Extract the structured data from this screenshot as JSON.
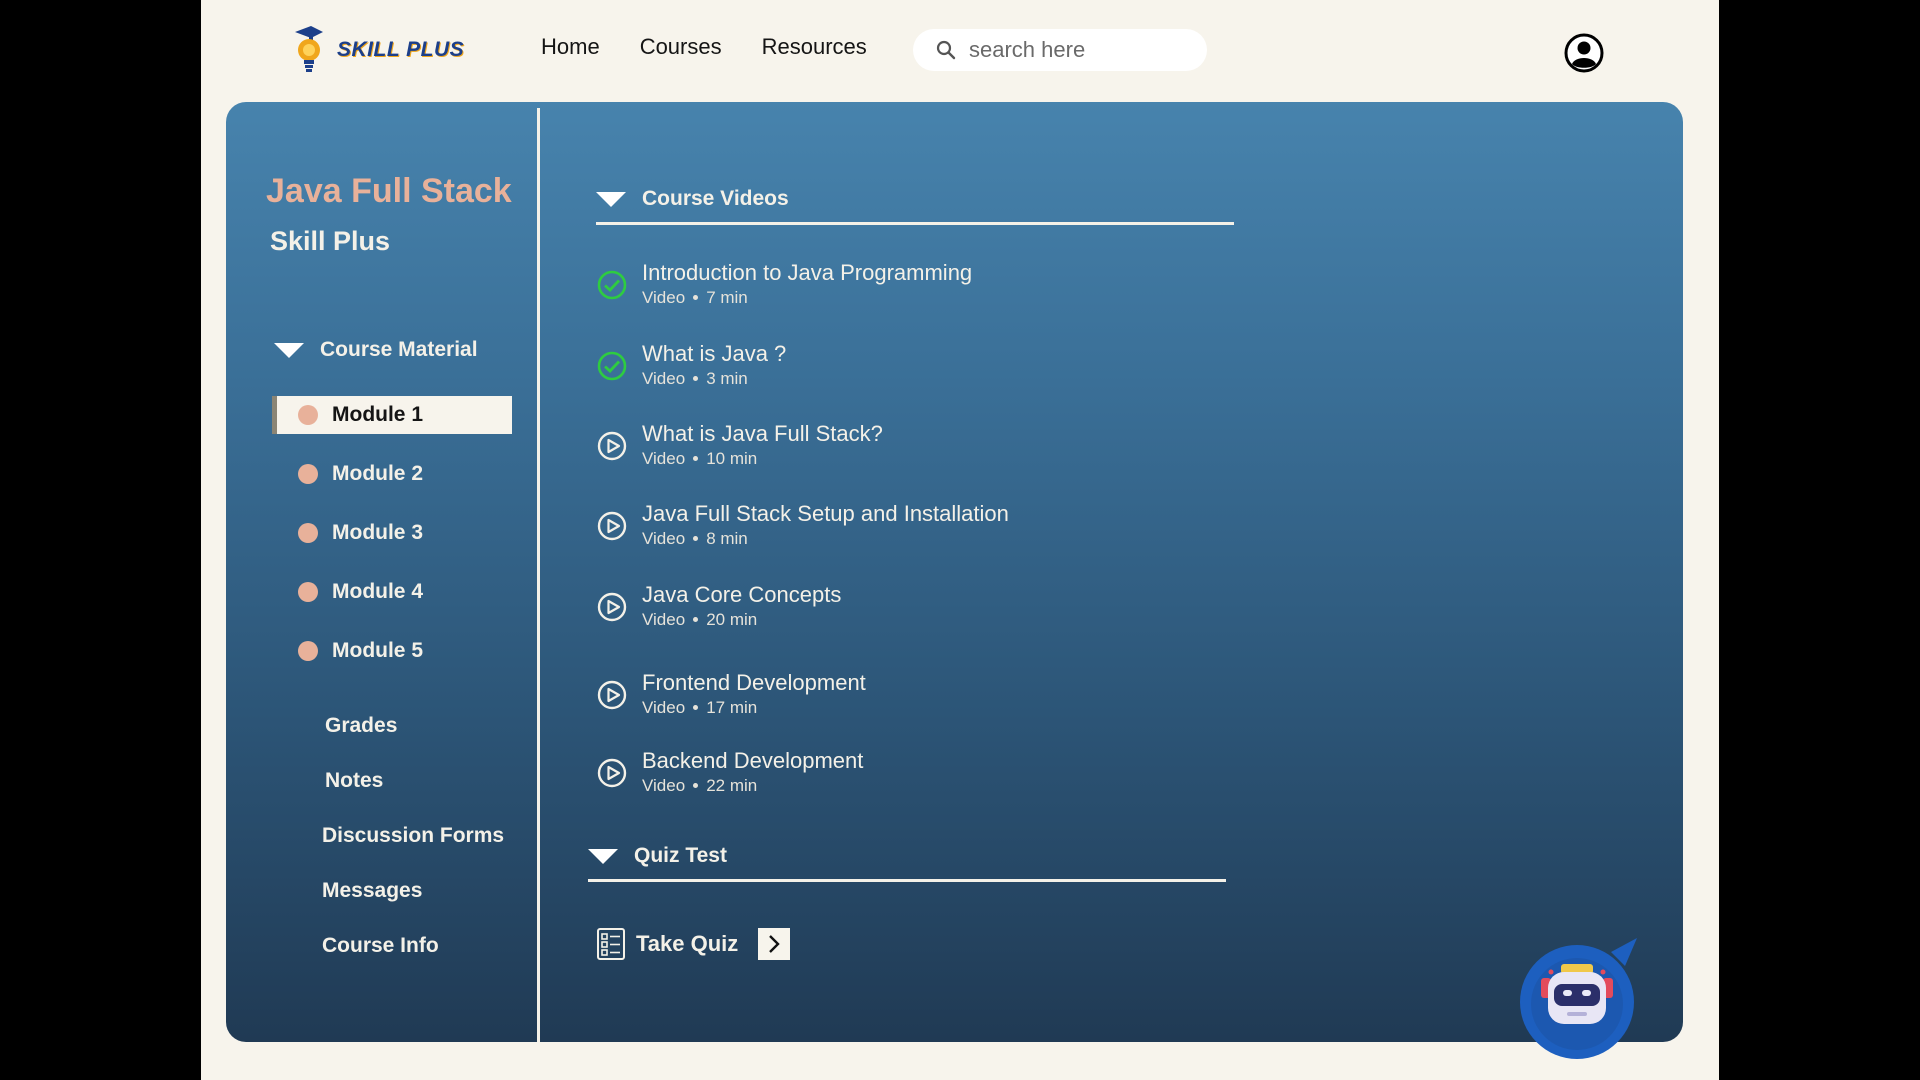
{
  "header": {
    "logo_text": "SKILL PLUS",
    "nav": [
      "Home",
      "Courses",
      "Resources"
    ],
    "search_placeholder": "search here"
  },
  "course": {
    "title": "Java Full Stack",
    "provider": "Skill Plus"
  },
  "sidebar": {
    "section_label": "Course Material",
    "modules": [
      "Module 1",
      "Module 2",
      "Module 3",
      "Module 4",
      "Module 5"
    ],
    "active_module": "Module 1",
    "links": [
      "Grades",
      "Notes",
      "Discussion Forms",
      "Messages",
      "Course Info"
    ]
  },
  "videos_section": {
    "label": "Course Videos",
    "items": [
      {
        "title": "Introduction to Java Programming",
        "type": "Video",
        "duration": "7 min",
        "status": "completed",
        "icon": "check-circle-icon"
      },
      {
        "title": "What is Java ?",
        "type": "Video",
        "duration": "3 min",
        "status": "completed",
        "icon": "check-circle-icon"
      },
      {
        "title": "What is Java Full Stack?",
        "type": "Video",
        "duration": "10 min",
        "status": "pending",
        "icon": "play-circle-icon"
      },
      {
        "title": "Java Full Stack Setup and Installation",
        "type": "Video",
        "duration": "8 min",
        "status": "pending",
        "icon": "play-circle-icon"
      },
      {
        "title": "Java Core Concepts",
        "type": "Video",
        "duration": "20 min",
        "status": "pending",
        "icon": "play-circle-icon"
      },
      {
        "title": "Frontend Development",
        "type": "Video",
        "duration": "17 min",
        "status": "pending",
        "icon": "play-circle-icon"
      },
      {
        "title": "Backend Development",
        "type": "Video",
        "duration": "22 min",
        "status": "pending",
        "icon": "play-circle-icon"
      }
    ]
  },
  "quiz_section": {
    "label": "Quiz Test",
    "take_quiz_label": "Take Quiz"
  },
  "colors": {
    "accent_peach": "#e8b19a",
    "check_green": "#2ecc40",
    "panel_top": "#4783ad",
    "panel_bottom": "#203a54",
    "page_bg": "#f7f4ec"
  }
}
